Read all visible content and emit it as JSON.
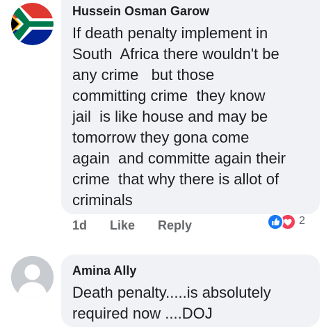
{
  "comments": [
    {
      "author": "Hussein Osman Garow",
      "text": "If death penalty implement in\nSouth  Africa there wouldn't be\nany crime   but those\ncommitting crime  they know\njail  is like house and may be\ntomorrow they gona come\nagain  and committe again their\ncrime  that why there is allot of\ncriminals",
      "avatar_icon": "south-africa-flag-icon",
      "actions": {
        "time": "1d",
        "like_label": "Like",
        "reply_label": "Reply"
      },
      "reactions": {
        "icons": [
          "like-reaction-icon",
          "love-reaction-icon"
        ],
        "count": "2"
      }
    },
    {
      "author": "Amina Ally",
      "text": "Death penalty.....is absolutely\nrequired now ....DOJ",
      "avatar_icon": "default-avatar-icon"
    }
  ],
  "colors": {
    "bubble_bg": "#f0f2f5",
    "text": "#1c1e21",
    "meta_text": "#65676b",
    "like_blue": "#1877f2",
    "love_red": "#f33e58"
  }
}
